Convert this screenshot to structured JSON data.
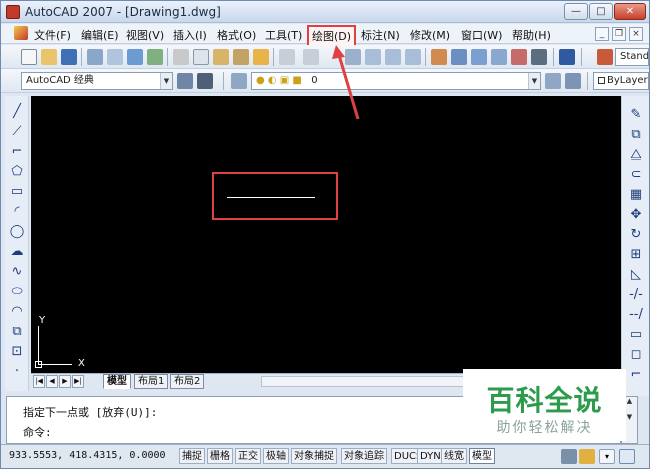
{
  "window": {
    "title": "AutoCAD 2007 - [Drawing1.dwg]",
    "min_glyph": "—",
    "max_glyph": "□",
    "close_glyph": "✕"
  },
  "menubar": {
    "items": [
      "文件(F)",
      "编辑(E)",
      "视图(V)",
      "插入(I)",
      "格式(O)",
      "工具(T)",
      "绘图(D)",
      "标注(N)",
      "修改(M)",
      "窗口(W)",
      "帮助(H)"
    ],
    "highlighted": "绘图(D)",
    "mdi_min": "_",
    "mdi_restore": "❐",
    "mdi_close": "×"
  },
  "toolbar": {
    "text_style_label": "Stand",
    "workspace": "AutoCAD 经典",
    "layer_current": "0",
    "linetype": "ByLayer"
  },
  "canvas": {
    "ucs_y_label": "Y",
    "ucs_x_label": "X"
  },
  "layout_tabs": {
    "nav": [
      "|◀",
      "◀",
      "▶",
      "▶|"
    ],
    "tabs": [
      "模型",
      "布局1",
      "布局2"
    ],
    "active": "模型"
  },
  "command": {
    "line1": "指定下一点或 [放弃(U)]:",
    "line2": "命令:"
  },
  "status": {
    "coordinates": "933.5553,  418.4315, 0.0000",
    "toggles": [
      "捕捉",
      "栅格",
      "正交",
      "极轴",
      "对象捕捉",
      "对象追踪",
      "DUCS",
      "DYN",
      "线宽",
      "模型"
    ],
    "active_toggles": [
      "模型"
    ]
  },
  "watermark": {
    "title": "百科全说",
    "subtitle": "助你轻松解决"
  },
  "colors": {
    "highlight": "#e04040",
    "canvas": "#000000",
    "watermark_green": "#2d9b4c"
  }
}
